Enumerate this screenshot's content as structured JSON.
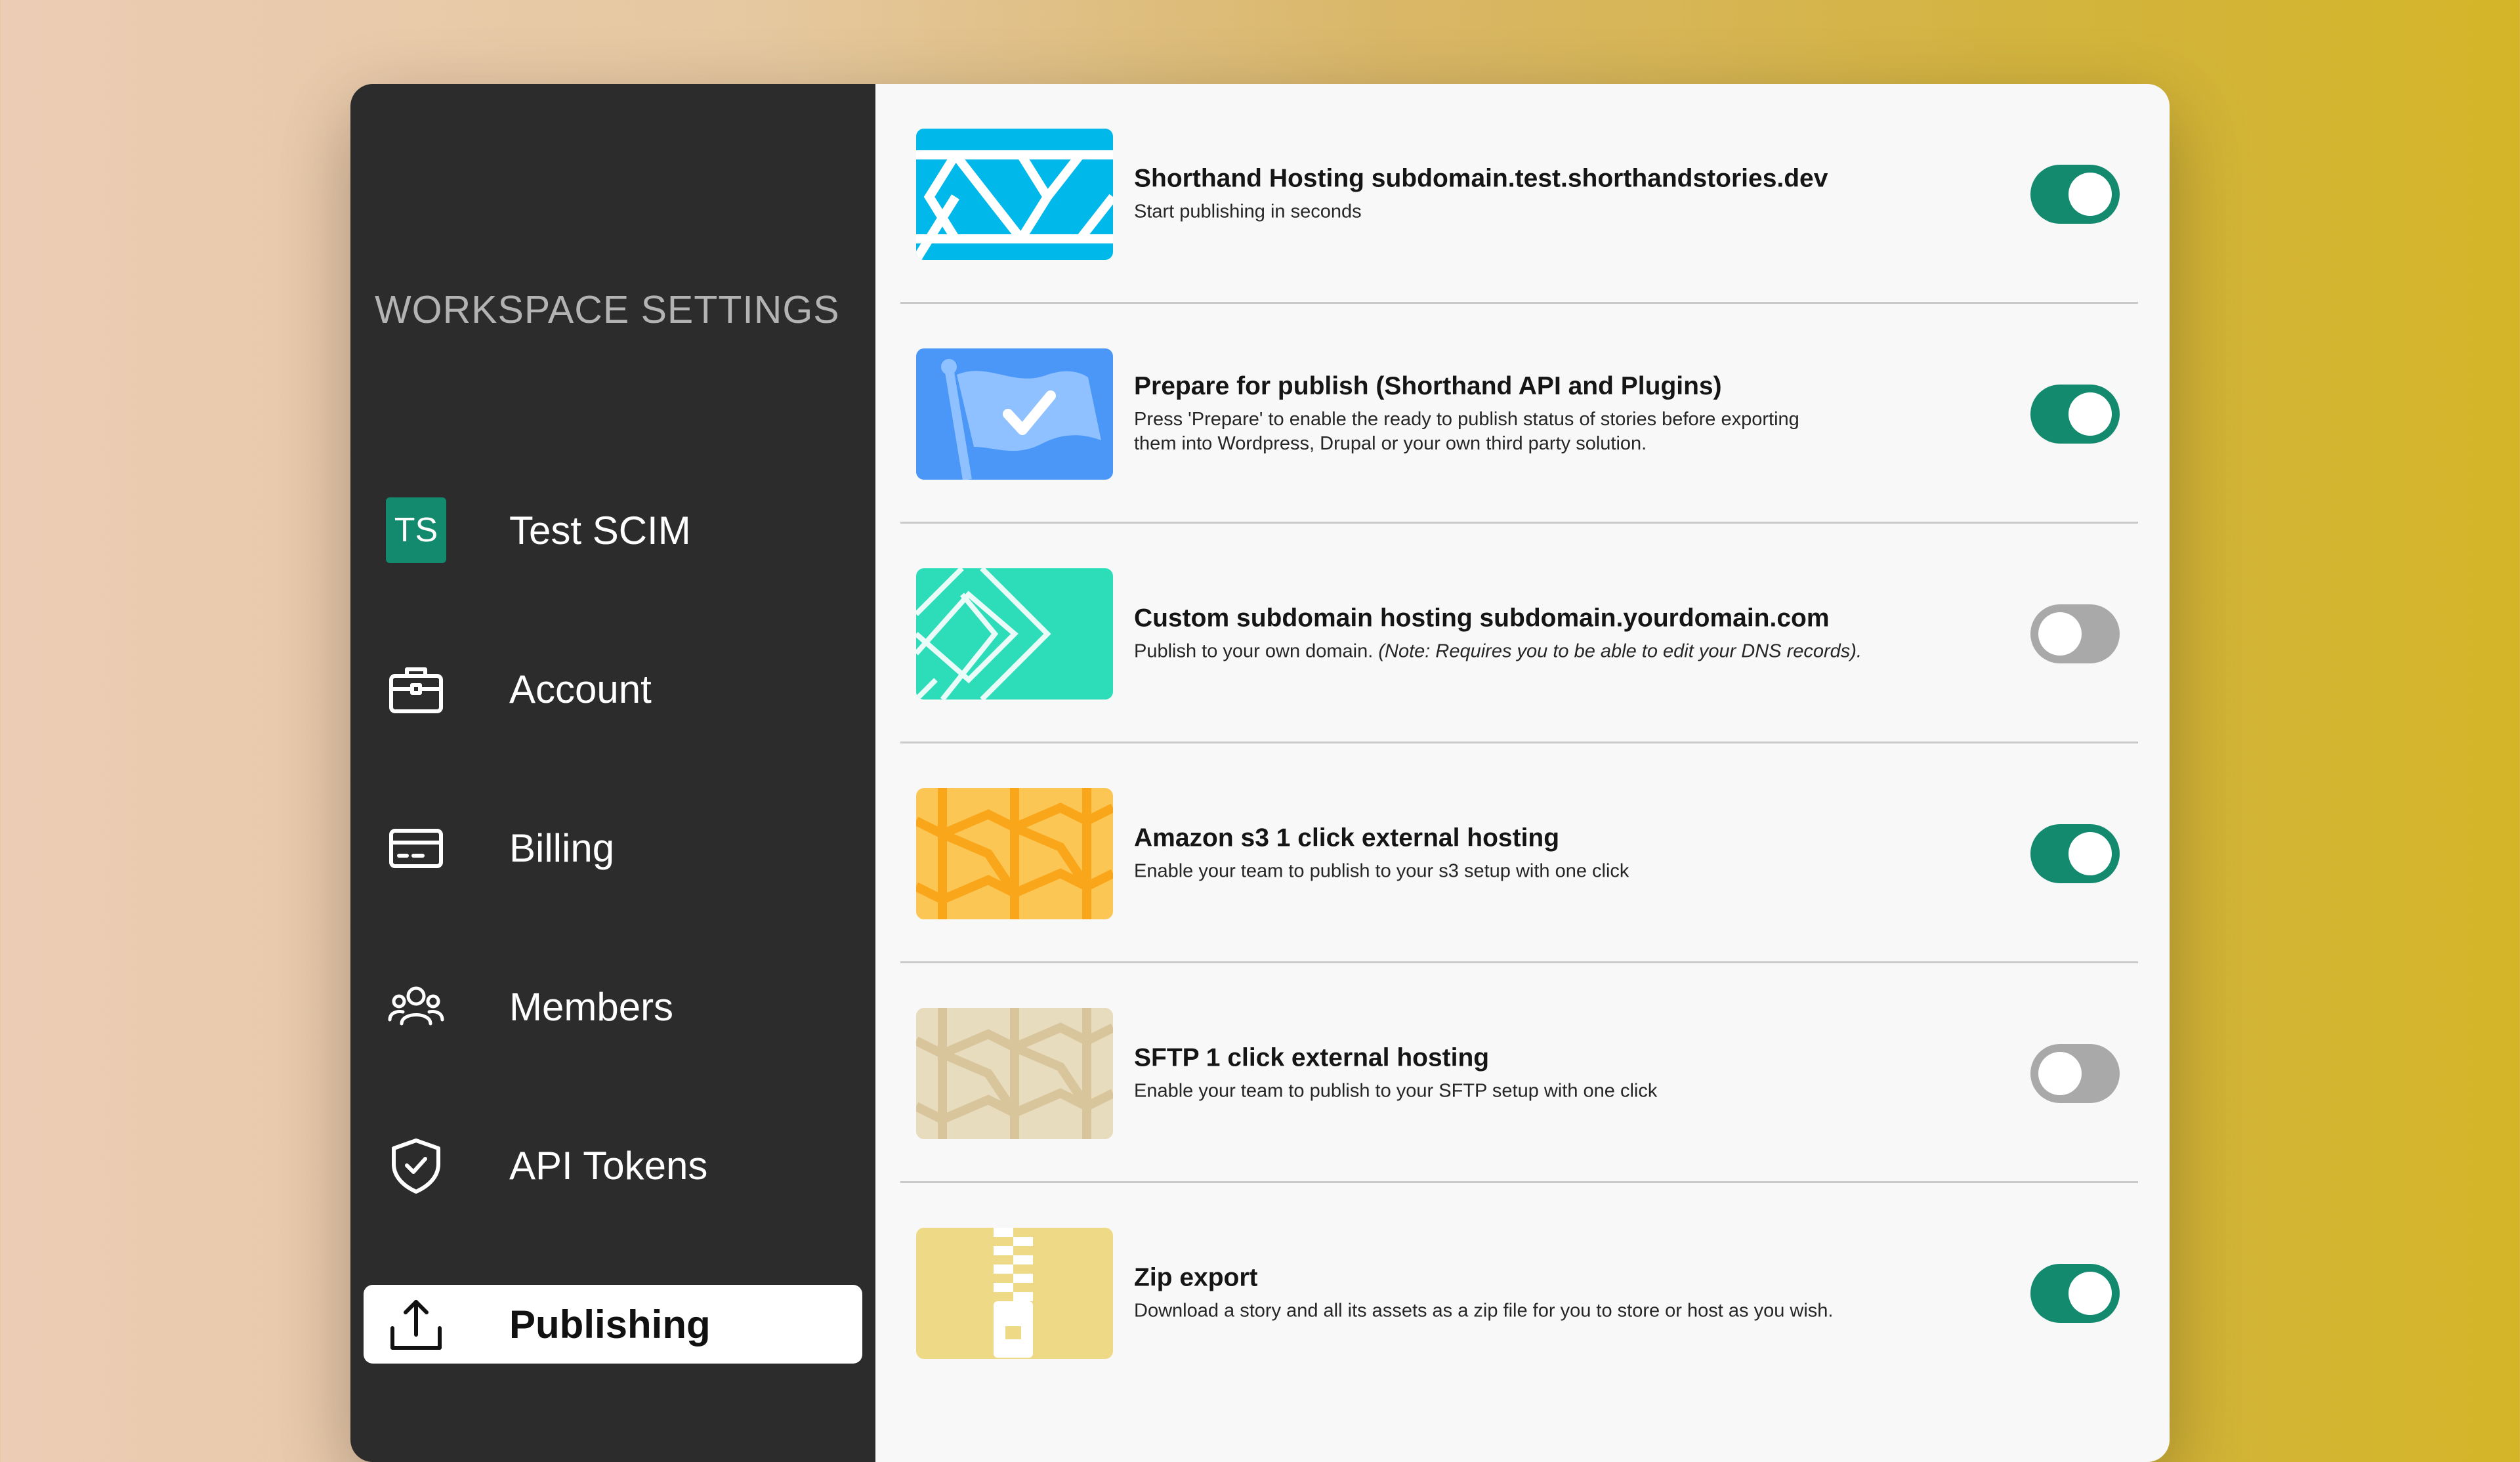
{
  "sidebar": {
    "title": "WORKSPACE SETTINGS",
    "items": [
      {
        "label": "Test SCIM",
        "badge": "TS",
        "icon": "workspace-badge"
      },
      {
        "label": "Account",
        "icon": "briefcase-icon"
      },
      {
        "label": "Billing",
        "icon": "credit-card-icon"
      },
      {
        "label": "Members",
        "icon": "users-icon"
      },
      {
        "label": "API Tokens",
        "icon": "shield-check-icon"
      },
      {
        "label": "Publishing",
        "icon": "upload-icon",
        "active": true
      }
    ]
  },
  "publishing": {
    "options": [
      {
        "title": "Shorthand Hosting subdomain.test.shorthandstories.dev",
        "description": "Start publishing in seconds",
        "enabled": true,
        "thumb_color": "#00b8ea"
      },
      {
        "title": "Prepare for publish (Shorthand API and Plugins)",
        "description": "Press 'Prepare' to enable the ready to publish status of stories before exporting them into Wordpress, Drupal or your own third party solution.",
        "enabled": true,
        "thumb_color": "#4a97f8"
      },
      {
        "title": "Custom subdomain hosting subdomain.yourdomain.com",
        "description": "Publish to your own domain. ",
        "note": "(Note: Requires you to be able to edit your DNS records).",
        "enabled": false,
        "thumb_color": "#2ddcb9"
      },
      {
        "title": "Amazon s3 1 click external hosting",
        "description": "Enable your team to publish to your s3 setup with one click",
        "enabled": true,
        "thumb_color": "#f9a61a"
      },
      {
        "title": "SFTP 1 click external hosting",
        "description": "Enable your team to publish to your SFTP setup with one click",
        "enabled": false,
        "thumb_color": "#d8c59b"
      },
      {
        "title": "Zip export",
        "description": "Download a story and all its assets as a zip file for you to store or host as you wish.",
        "enabled": true,
        "thumb_color": "#eed987"
      }
    ]
  },
  "colors": {
    "accent": "#138a6e",
    "toggle_off": "#a9a9a9",
    "sidebar_bg": "#2c2c2c",
    "content_bg": "#f8f8f8"
  }
}
